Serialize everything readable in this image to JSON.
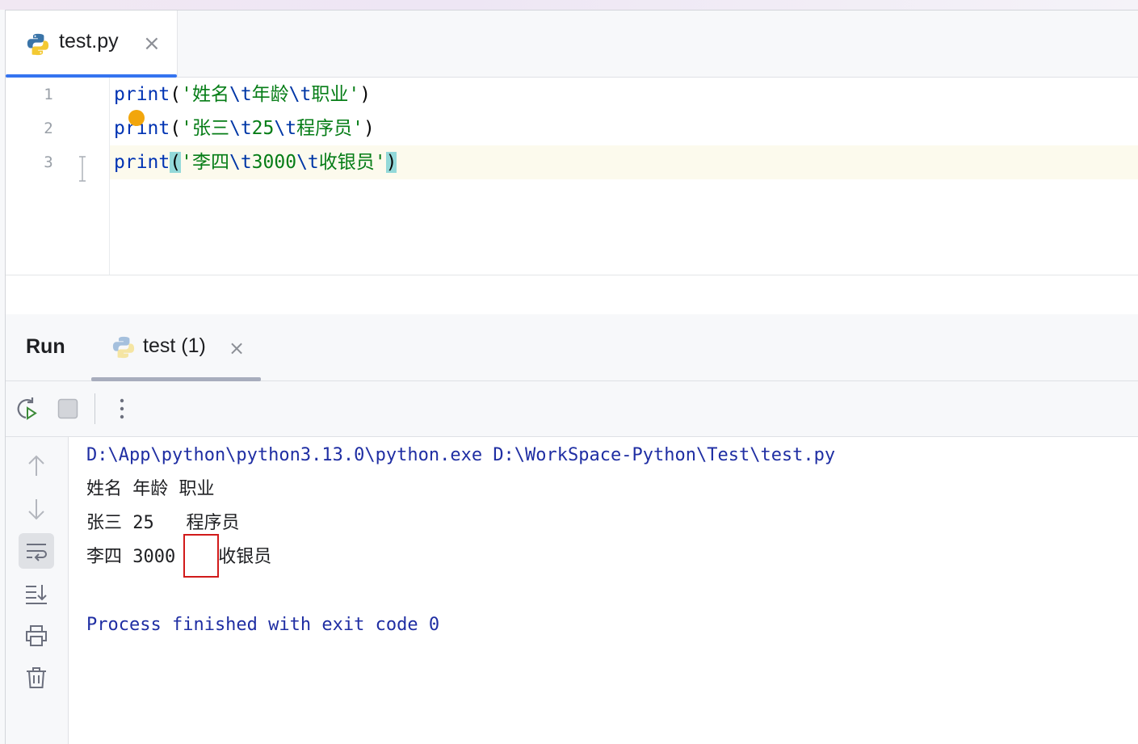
{
  "editor": {
    "tab": {
      "filename": "test.py"
    },
    "lines": [
      {
        "num": "1",
        "fn": "print",
        "open": "(",
        "q1": "'",
        "s1": "姓名",
        "e1": "\\t",
        "s2": "年龄",
        "e2": "\\t",
        "s3": "职业",
        "q2": "'",
        "close": ")"
      },
      {
        "num": "2",
        "fn": "print",
        "open": "(",
        "q1": "'",
        "s1": "张三",
        "e1": "\\t",
        "s2": "25",
        "e2": "\\t",
        "s3": "程序员",
        "q2": "'",
        "close": ")"
      },
      {
        "num": "3",
        "fn": "print",
        "open": "(",
        "q1": "'",
        "s1": "李四",
        "e1": "\\t",
        "s2": "3000",
        "e2": "\\t",
        "s3": "收银员",
        "q2": "'",
        "close": ")"
      }
    ]
  },
  "run": {
    "title": "Run",
    "tab": {
      "name": "test (1)"
    }
  },
  "console": {
    "command": "D:\\App\\python\\python3.13.0\\python.exe D:\\WorkSpace-Python\\Test\\test.py",
    "output": [
      "姓名 年龄 职业",
      "张三 25   程序员",
      "李四 3000    收银员"
    ],
    "finish": "Process finished with exit code 0"
  },
  "icons": {
    "rerun": "rerun-icon",
    "stop": "stop-icon",
    "more": "more-vertical-icon",
    "up": "arrow-up-icon",
    "down": "arrow-down-icon",
    "wrap": "soft-wrap-icon",
    "scroll": "scroll-to-end-icon",
    "print": "print-icon",
    "trash": "trash-icon"
  },
  "colors": {
    "accent": "#3574f0",
    "keyword": "#0033b3",
    "string": "#067d17",
    "console_system": "#1f2ea3",
    "highlight": "#d11a1a"
  }
}
